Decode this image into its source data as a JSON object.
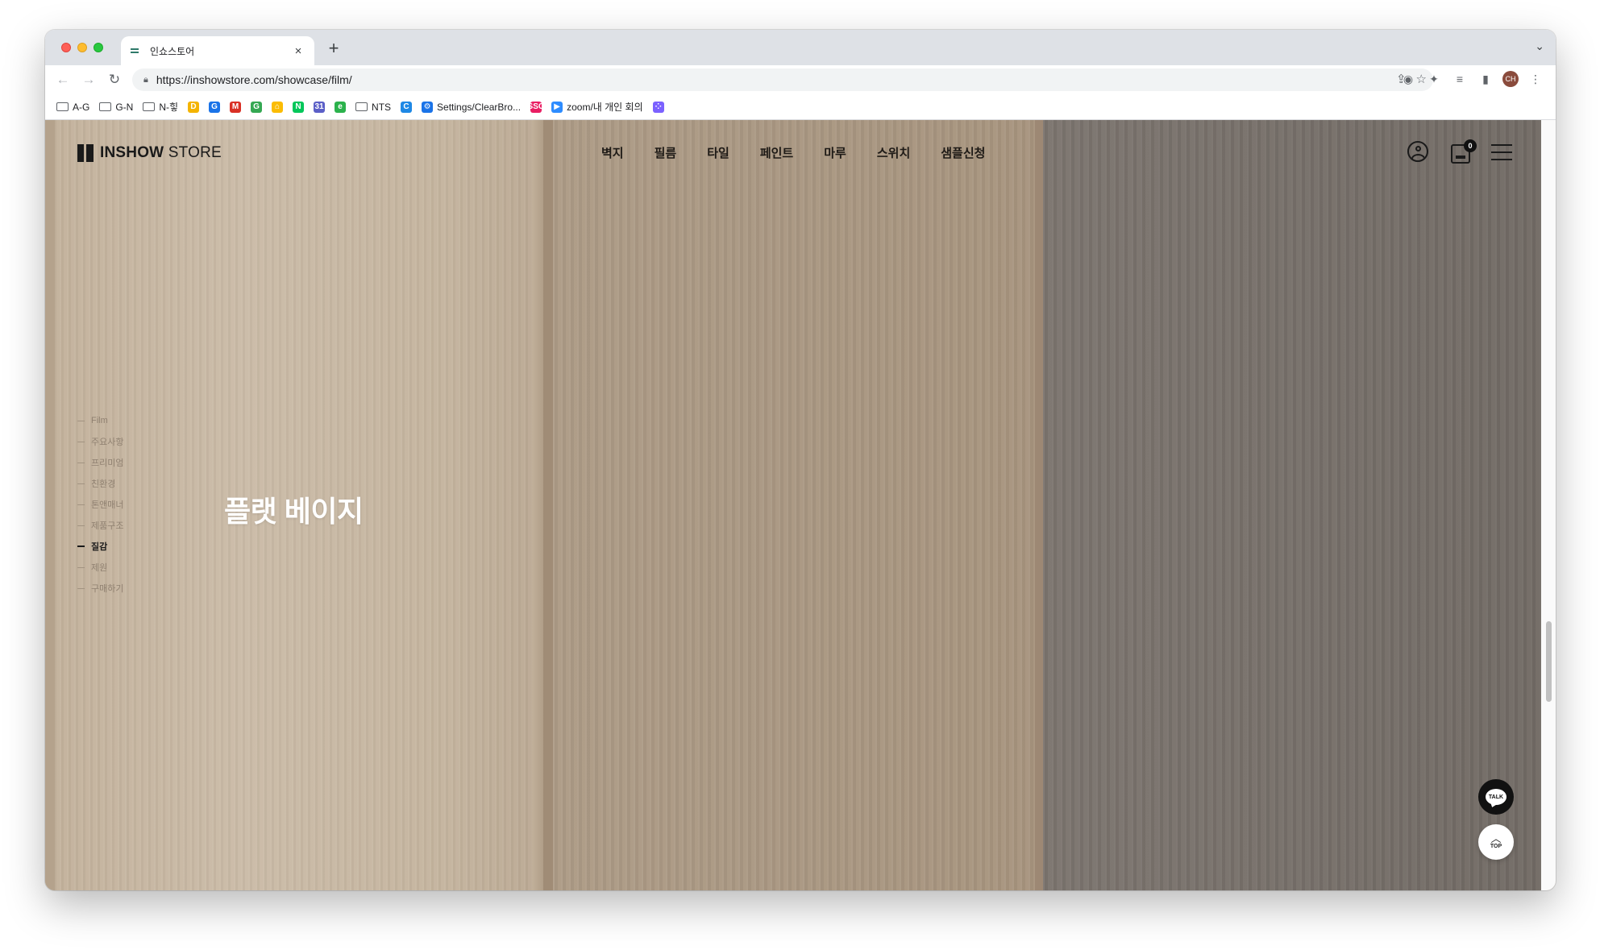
{
  "browser": {
    "tab_title": "인쇼스토어",
    "url_prefix": "https://",
    "url_host": "inshowstore.com",
    "url_path": "/showcase/film/",
    "profile_initials": "CH"
  },
  "bookmarks": [
    {
      "label": "A-G",
      "type": "folder"
    },
    {
      "label": "G-N",
      "type": "folder"
    },
    {
      "label": "N-힣",
      "type": "folder"
    },
    {
      "label": "",
      "type": "favicon",
      "glyph": "D",
      "color": "#f4b400"
    },
    {
      "label": "",
      "type": "favicon",
      "glyph": "G",
      "color": "#1a73e8"
    },
    {
      "label": "",
      "type": "favicon",
      "glyph": "M",
      "color": "#d93025"
    },
    {
      "label": "",
      "type": "favicon",
      "glyph": "G",
      "color": "#34a853"
    },
    {
      "label": "",
      "type": "favicon",
      "glyph": "⌂",
      "color": "#fbbc04"
    },
    {
      "label": "",
      "type": "favicon",
      "glyph": "N",
      "color": "#03c75a"
    },
    {
      "label": "",
      "type": "favicon",
      "glyph": "31",
      "color": "#5b5fc7"
    },
    {
      "label": "",
      "type": "favicon",
      "glyph": "e",
      "color": "#2bb24c"
    },
    {
      "label": "NTS",
      "type": "folder"
    },
    {
      "label": "",
      "type": "favicon",
      "glyph": "C",
      "color": "#1e88e5"
    },
    {
      "label": "Settings/ClearBro...",
      "type": "favicon",
      "glyph": "⚙",
      "color": "#1a73e8"
    },
    {
      "label": "",
      "type": "favicon",
      "glyph": "SSG",
      "color": "#e91e63"
    },
    {
      "label": "zoom/내 개인 회의",
      "type": "favicon",
      "glyph": "▶",
      "color": "#2d8cff"
    },
    {
      "label": "",
      "type": "favicon",
      "glyph": "⁘",
      "color": "#7b61ff"
    }
  ],
  "site": {
    "logo_bold": "INSHOW",
    "logo_light": " STORE",
    "nav": [
      "벽지",
      "필름",
      "타일",
      "페인트",
      "마루",
      "스위치",
      "샘플신청"
    ],
    "cart_count": "0",
    "side_menu": [
      {
        "label": "Film",
        "active": false
      },
      {
        "label": "주요사항",
        "active": false
      },
      {
        "label": "프리미엄",
        "active": false
      },
      {
        "label": "친환경",
        "active": false
      },
      {
        "label": "톤앤매너",
        "active": false
      },
      {
        "label": "제품구조",
        "active": false
      },
      {
        "label": "질감",
        "active": true
      },
      {
        "label": "제원",
        "active": false
      },
      {
        "label": "구매하기",
        "active": false
      }
    ],
    "panel_title": "플랫 베이지",
    "talk_label": "TALK",
    "top_label": "TOP"
  },
  "colors": {
    "panel_1": "#c5b5a0",
    "panel_2": "#aa9883",
    "panel_3": "#78716b",
    "accent_dark": "#111111"
  }
}
